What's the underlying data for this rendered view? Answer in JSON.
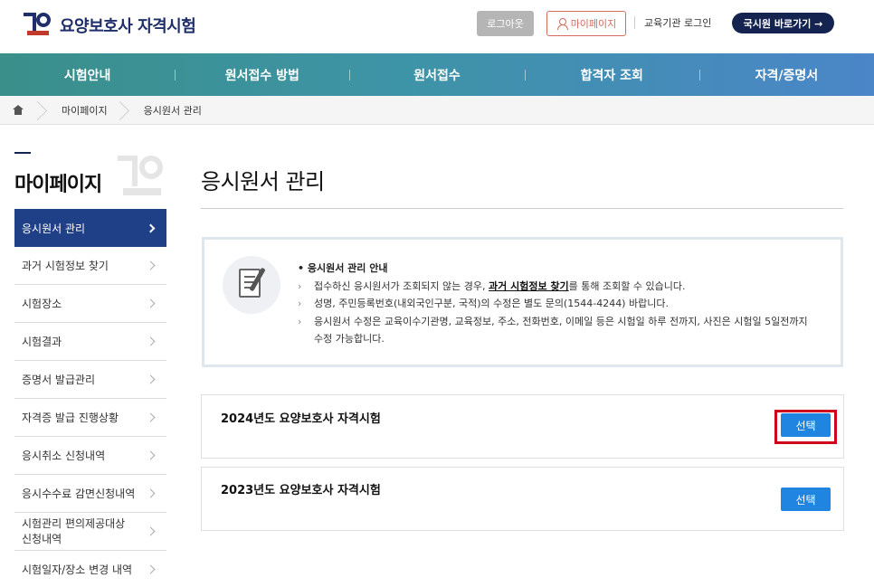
{
  "header": {
    "brand": "요양보호사 자격시험",
    "logout_label": "로그아웃",
    "mypage_label": "마이페이지",
    "edu_login_label": "교육기관 로그인",
    "goto_label": "국시원 바로가기 →"
  },
  "nav": {
    "items": [
      "시험안내",
      "원서접수 방법",
      "원서접수",
      "합격자 조회",
      "자격/증명서"
    ]
  },
  "breadcrumb": {
    "items": [
      "마이페이지",
      "응시원서 관리"
    ]
  },
  "sidebar": {
    "title": "마이페이지",
    "items": [
      {
        "label": "응시원서 관리",
        "active": true
      },
      {
        "label": "과거 시험정보 찾기"
      },
      {
        "label": "시험장소"
      },
      {
        "label": "시험결과"
      },
      {
        "label": "증명서 발급관리"
      },
      {
        "label": "자격증 발급 진행상황"
      },
      {
        "label": "응시취소 신청내역"
      },
      {
        "label": "응시수수료 감면신청내역"
      },
      {
        "label": "시험관리 편의제공대상\n신청내역"
      },
      {
        "label": "시험일자/장소 변경 내역"
      }
    ]
  },
  "main": {
    "page_title": "응시원서 관리",
    "notice": {
      "heading": "응시원서 관리 안내",
      "line1_pre": "접수하신 응시원서가 조회되지 않는 경우, ",
      "line1_link": "과거 시험정보 찾기",
      "line1_post": "를 통해 조회할 수 있습니다.",
      "line2": "성명, 주민등록번호(내외국인구분, 국적)의 수정은 별도 문의(1544-4244) 바랍니다.",
      "line3": "응시원서 수정은 교육이수기관명, 교육정보, 주소, 전화번호, 이메일 등은 시험일 하루 전까지, 사진은 시험일 5일전까지 수정 가능합니다.",
      "arrow": "›"
    },
    "exams": [
      {
        "title": "2024년도 요양보호사 자격시험",
        "button": "선택"
      },
      {
        "title": "2023년도 요양보호사 자격시험",
        "button": "선택"
      }
    ]
  }
}
